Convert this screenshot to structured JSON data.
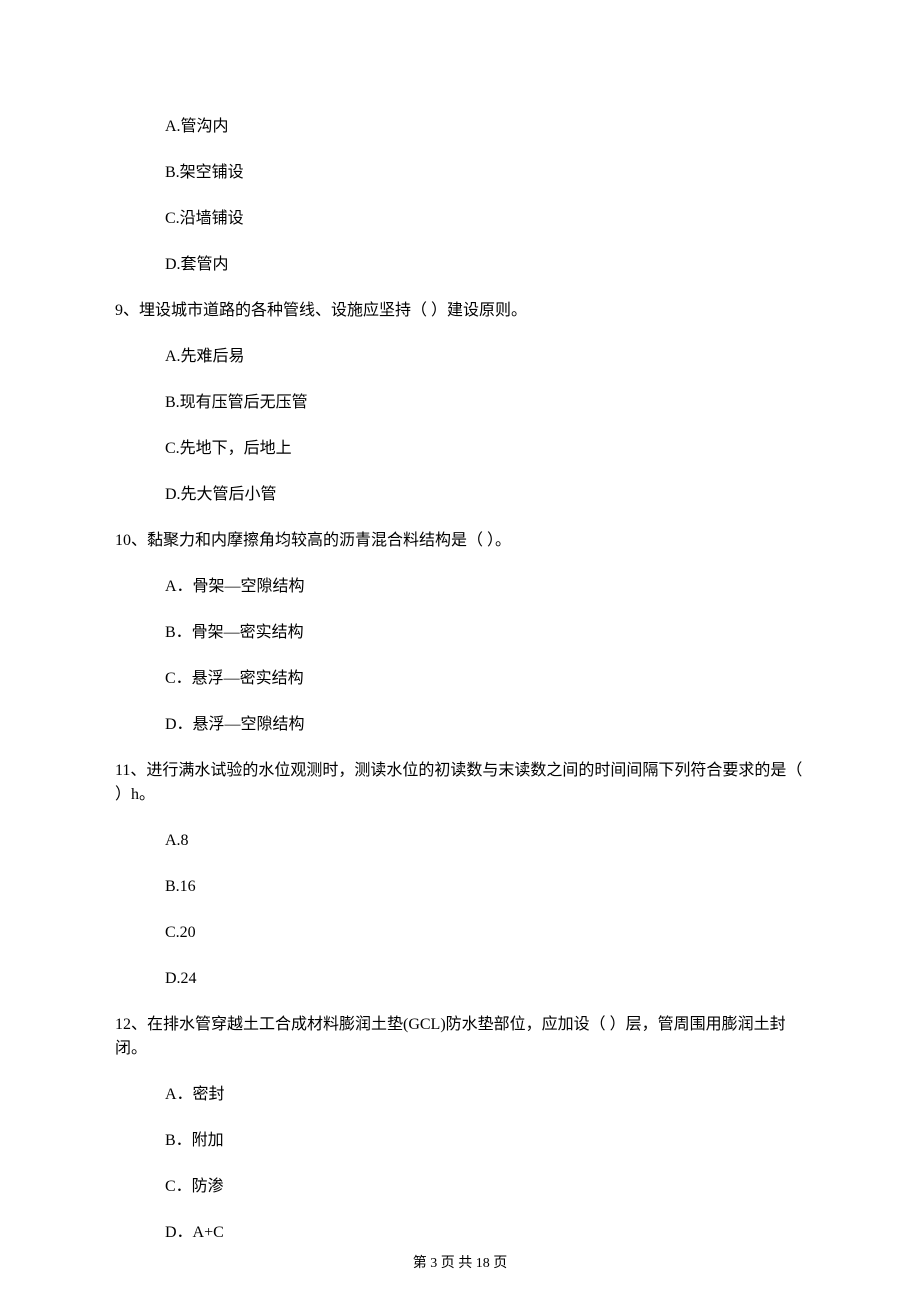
{
  "q8": {
    "options": {
      "a": "A.管沟内",
      "b": "B.架空铺设",
      "c": "C.沿墙铺设",
      "d": "D.套管内"
    }
  },
  "q9": {
    "text": "9、埋设城市道路的各种管线、设施应坚持（    ）建设原则。",
    "options": {
      "a": "A.先难后易",
      "b": "B.现有压管后无压管",
      "c": "C.先地下，后地上",
      "d": "D.先大管后小管"
    }
  },
  "q10": {
    "text": "10、黏聚力和内摩擦角均较高的沥青混合料结构是（    ）。",
    "options": {
      "a": "A．骨架—空隙结构",
      "b": "B．骨架—密实结构",
      "c": "C．悬浮—密实结构",
      "d": "D．悬浮—空隙结构"
    }
  },
  "q11": {
    "text": "11、进行满水试验的水位观测时，测读水位的初读数与末读数之间的时间间隔下列符合要求的是（    ）h。",
    "options": {
      "a": "A.8",
      "b": "B.16",
      "c": "C.20",
      "d": "D.24"
    }
  },
  "q12": {
    "text": "12、在排水管穿越土工合成材料膨润土垫(GCL)防水垫部位，应加设（    ）层，管周围用膨润土封闭。",
    "options": {
      "a": "A．密封",
      "b": "B．附加",
      "c": "C．防渗",
      "d": "D．A+C"
    }
  },
  "pager": "第 3 页 共 18 页"
}
